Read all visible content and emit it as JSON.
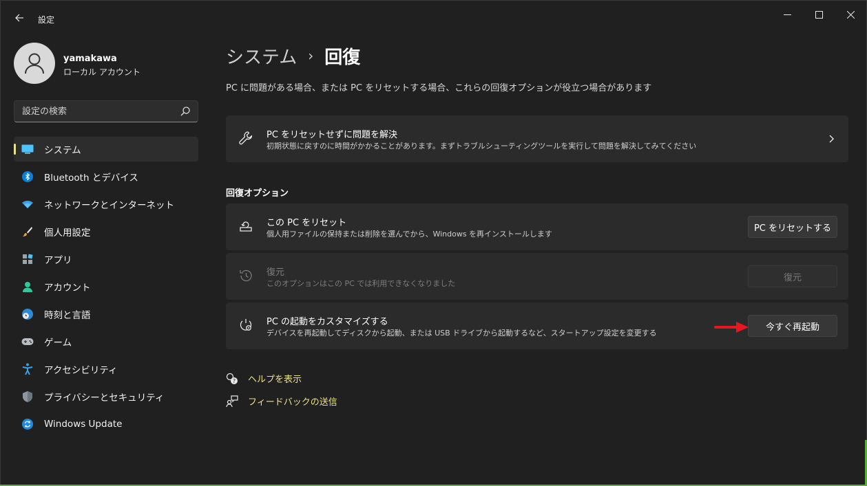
{
  "window": {
    "app_title": "設定"
  },
  "user": {
    "name": "yamakawa",
    "account_type": "ローカル アカウント"
  },
  "search": {
    "placeholder": "設定の検索"
  },
  "sidebar": {
    "items": [
      {
        "label": "システム",
        "icon": "system-icon",
        "active": true
      },
      {
        "label": "Bluetooth とデバイス",
        "icon": "bluetooth-icon"
      },
      {
        "label": "ネットワークとインターネット",
        "icon": "wifi-icon"
      },
      {
        "label": "個人用設定",
        "icon": "brush-icon"
      },
      {
        "label": "アプリ",
        "icon": "apps-icon"
      },
      {
        "label": "アカウント",
        "icon": "account-icon"
      },
      {
        "label": "時刻と言語",
        "icon": "globe-clock-icon"
      },
      {
        "label": "ゲーム",
        "icon": "gamepad-icon"
      },
      {
        "label": "アクセシビリティ",
        "icon": "accessibility-icon"
      },
      {
        "label": "プライバシーとセキュリティ",
        "icon": "shield-icon"
      },
      {
        "label": "Windows Update",
        "icon": "update-icon"
      }
    ]
  },
  "breadcrumb": {
    "parent": "システム",
    "separator": "›",
    "current": "回復"
  },
  "description": "PC に問題がある場合、または PC をリセットする場合、これらの回復オプションが役立つ場合があります",
  "troubleshoot_card": {
    "title": "PC をリセットせずに問題を解決",
    "subtitle": "初期状態に戻すのに時間がかかることがあります。まずトラブルシューティングツールを実行して問題を解決してみてください"
  },
  "section_title": "回復オプション",
  "options": [
    {
      "title": "この PC をリセット",
      "subtitle": "個人用ファイルの保持または削除を選んでから、Windows を再インストールします",
      "button": "PC をリセットする",
      "enabled": true
    },
    {
      "title": "復元",
      "subtitle": "このオプションはこの PC では利用できなくなりました",
      "button": "復元",
      "enabled": false
    },
    {
      "title": "PC の起動をカスタマイズする",
      "subtitle": "デバイスを再起動してディスクから起動、または USB ドライブから起動するなど、スタートアップ設定を変更する",
      "button": "今すぐ再起動",
      "enabled": true
    }
  ],
  "links": {
    "help": "ヘルプを表示",
    "feedback": "フィードバックの送信"
  },
  "colors": {
    "accent": "#e8e28a",
    "annotation_arrow": "#e8171f"
  }
}
